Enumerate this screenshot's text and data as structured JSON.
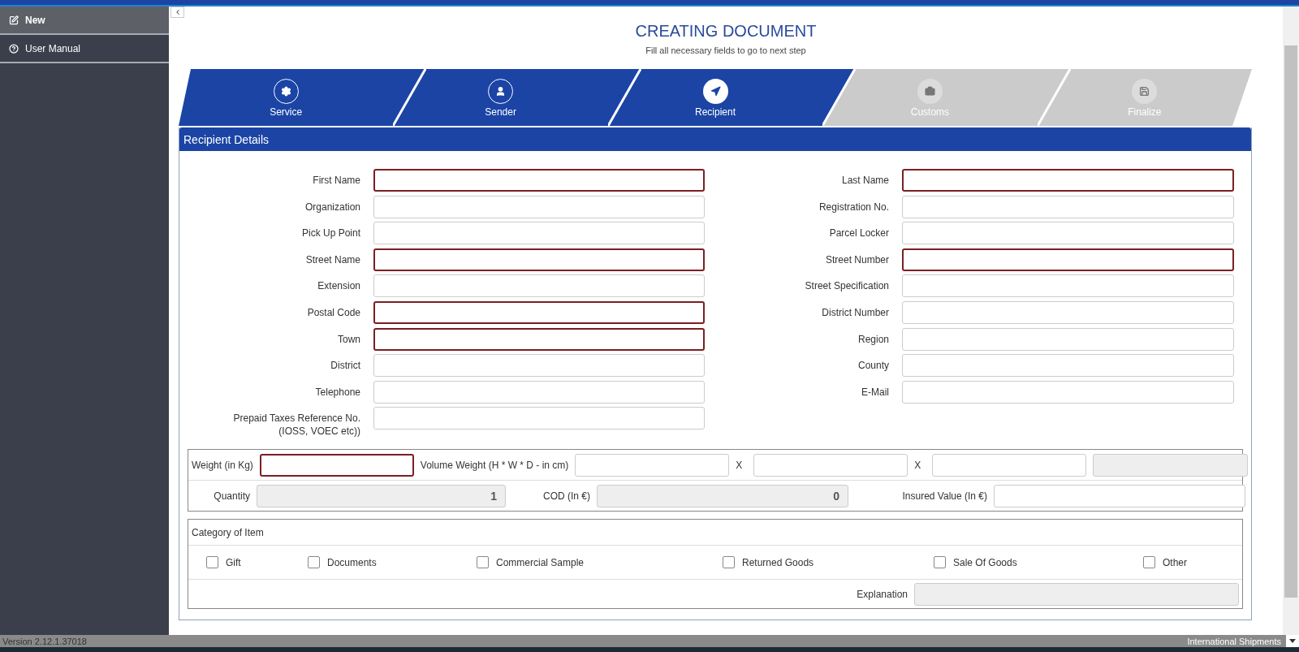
{
  "sidebar": {
    "items": [
      {
        "label": "New",
        "selected": true
      },
      {
        "label": "User Manual",
        "selected": false
      }
    ]
  },
  "header": {
    "title": "CREATING DOCUMENT",
    "subtitle": "Fill all necessary fields to go to next step"
  },
  "steps": [
    {
      "label": "Service",
      "selected": false,
      "disabled": false
    },
    {
      "label": "Sender",
      "selected": false,
      "disabled": false
    },
    {
      "label": "Recipient",
      "selected": true,
      "disabled": false
    },
    {
      "label": "Customs",
      "selected": false,
      "disabled": true
    },
    {
      "label": "Finalize",
      "selected": false,
      "disabled": true
    }
  ],
  "panel": {
    "title": "Recipient Details"
  },
  "left_fields": [
    {
      "label": "First Name",
      "required": true
    },
    {
      "label": "Organization",
      "required": false
    },
    {
      "label": "Pick Up Point",
      "required": false
    },
    {
      "label": "Street Name",
      "required": true
    },
    {
      "label": "Extension",
      "required": false
    },
    {
      "label": "Postal Code",
      "required": true
    },
    {
      "label": "Town",
      "required": true
    },
    {
      "label": "District",
      "required": false
    },
    {
      "label": "Telephone",
      "required": false
    },
    {
      "label": "Prepaid Taxes Reference No. (IOSS, VOEC etc))",
      "required": false
    }
  ],
  "right_fields": [
    {
      "label": "Last Name",
      "required": true
    },
    {
      "label": "Registration No.",
      "required": false
    },
    {
      "label": "Parcel Locker",
      "required": false
    },
    {
      "label": "Street Number",
      "required": true
    },
    {
      "label": "Street Specification",
      "required": false
    },
    {
      "label": "District Number",
      "required": false
    },
    {
      "label": "Region",
      "required": false
    },
    {
      "label": "County",
      "required": false
    },
    {
      "label": "E-Mail",
      "required": false
    }
  ],
  "dimensions": {
    "weight_label": "Weight (in Kg)",
    "volume_label": "Volume Weight (H * W * D - in cm)",
    "separators": [
      "X",
      "X"
    ],
    "quantity_label": "Quantity",
    "quantity_value": "1",
    "cod_label": "COD (In €)",
    "cod_value": "0",
    "insured_label": "Insured Value (In €)"
  },
  "category": {
    "title": "Category of Item",
    "options": [
      {
        "label": "Gift",
        "checked": false
      },
      {
        "label": "Documents",
        "checked": false
      },
      {
        "label": "Commercial Sample",
        "checked": false
      },
      {
        "label": "Returned Goods",
        "checked": false
      },
      {
        "label": "Sale Of Goods",
        "checked": false
      },
      {
        "label": "Other",
        "checked": false
      }
    ],
    "explanation_label": "Explanation"
  },
  "status_bar": {
    "version": "Version 2.12.1.37018",
    "module": "International Shipments"
  }
}
